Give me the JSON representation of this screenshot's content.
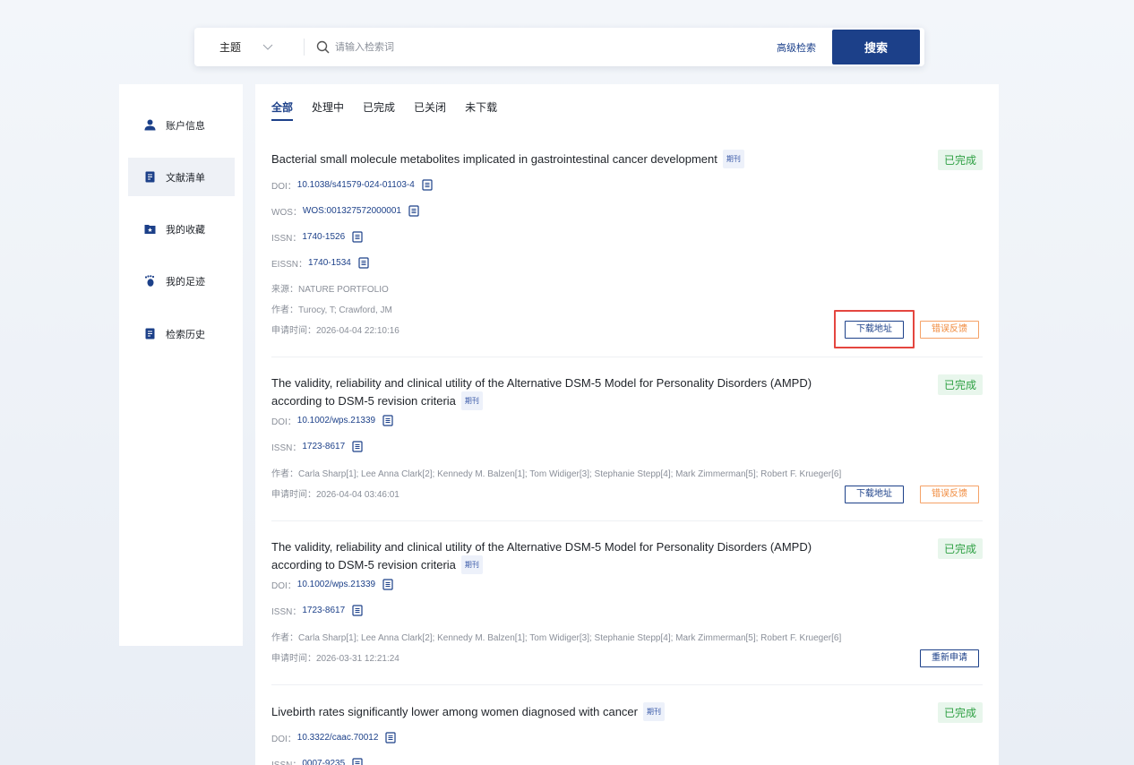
{
  "search": {
    "scope": "主题",
    "placeholder": "请输入检索词",
    "advanced": "高级检索",
    "button": "搜索"
  },
  "sidebar": {
    "items": [
      {
        "label": "账户信息",
        "icon": "user-icon"
      },
      {
        "label": "文献清单",
        "icon": "document-list-icon",
        "active": true
      },
      {
        "label": "我的收藏",
        "icon": "star-folder-icon"
      },
      {
        "label": "我的足迹",
        "icon": "footprint-icon"
      },
      {
        "label": "检索历史",
        "icon": "history-document-icon"
      }
    ]
  },
  "tabs": [
    {
      "label": "全部",
      "active": true
    },
    {
      "label": "处理中"
    },
    {
      "label": "已完成"
    },
    {
      "label": "已关闭"
    },
    {
      "label": "未下载"
    }
  ],
  "records": [
    {
      "title": "Bacterial small molecule metabolites implicated in gastrointestinal cancer development",
      "tag": "期刊",
      "status": "已完成",
      "doi_label": "DOI：",
      "doi": "10.1038/s41579-024-01103-4",
      "wos_label": "WOS：",
      "wos": "WOS:001327572000001",
      "issn_label": "ISSN：",
      "issn": "1740-1526",
      "eissn_label": "EISSN：",
      "eissn": "1740-1534",
      "source": "来源：NATURE PORTFOLIO",
      "authors": "作者：Turocy, T; Crawford, JM",
      "time": "申请时间：2026-04-04 22:10:16",
      "btn_download": "下载地址",
      "btn_feedback": "错误反馈"
    },
    {
      "title": "The validity, reliability and clinical utility of the Alternative DSM-5 Model for Personality Disorders (AMPD) according to DSM-5 revision criteria",
      "tag": "期刊",
      "status": "已完成",
      "doi_label": "DOI：",
      "doi": "10.1002/wps.21339",
      "issn_label": "ISSN：",
      "issn": "1723-8617",
      "authors": "作者：Carla Sharp[1]; Lee Anna Clark[2]; Kennedy M. Balzen[1]; Tom Widiger[3]; Stephanie Stepp[4]; Mark Zimmerman[5]; Robert F. Krueger[6]",
      "time": "申请时间：2026-04-04 03:46:01",
      "btn_download": "下载地址",
      "btn_feedback": "错误反馈"
    },
    {
      "title": "The validity, reliability and clinical utility of the Alternative DSM-5 Model for Personality Disorders (AMPD) according to DSM-5 revision criteria",
      "tag": "期刊",
      "status": "已完成",
      "doi_label": "DOI：",
      "doi": "10.1002/wps.21339",
      "issn_label": "ISSN：",
      "issn": "1723-8617",
      "authors": "作者：Carla Sharp[1]; Lee Anna Clark[2]; Kennedy M. Balzen[1]; Tom Widiger[3]; Stephanie Stepp[4]; Mark Zimmerman[5]; Robert F. Krueger[6]",
      "time": "申请时间：2026-03-31 12:21:24",
      "btn_reapply": "重新申请"
    },
    {
      "title": "Livebirth rates significantly lower among women diagnosed with cancer",
      "tag": "期刊",
      "status": "已完成",
      "doi_label": "DOI：",
      "doi": "10.3322/caac.70012",
      "issn_label": "ISSN：",
      "issn": "0007-9235"
    }
  ],
  "colors": {
    "brand": "#1c4089",
    "success": "#2ea043",
    "warning": "#f08a3c",
    "highlight": "#e4463f"
  }
}
